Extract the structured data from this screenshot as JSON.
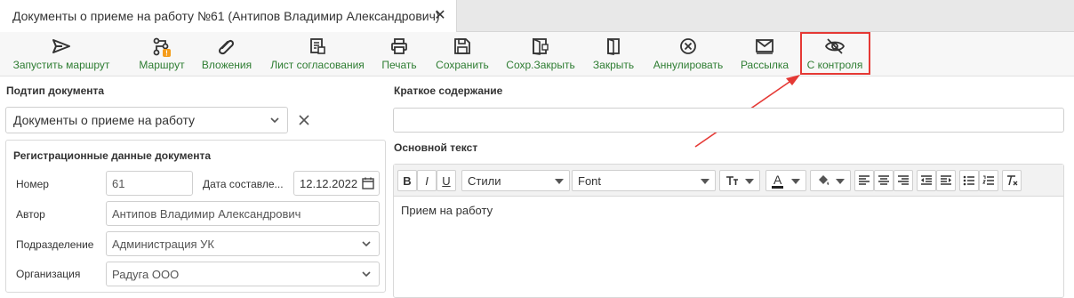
{
  "tab": {
    "title": "Документы о приеме на работу №61 (Антипов Владимир Александрович)",
    "close_icon": "close-icon"
  },
  "toolbar": {
    "buttons": [
      {
        "label": "Запустить маршрут",
        "icon": "send-icon"
      },
      {
        "label": "Маршрут",
        "icon": "route-icon"
      },
      {
        "label": "Вложения",
        "icon": "paperclip-icon"
      },
      {
        "label": "Лист согласования",
        "icon": "approval-sheet-icon"
      },
      {
        "label": "Печать",
        "icon": "printer-icon"
      },
      {
        "label": "Сохранить",
        "icon": "save-icon"
      },
      {
        "label": "Сохр.Закрыть",
        "icon": "save-close-icon"
      },
      {
        "label": "Закрыть",
        "icon": "close-door-icon"
      },
      {
        "label": "Аннулировать",
        "icon": "cancel-circle-icon"
      },
      {
        "label": "Рассылка",
        "icon": "mail-icon"
      },
      {
        "label": "С контроля",
        "icon": "eye-off-icon"
      }
    ],
    "label_color": "#2e7d32",
    "route_badge": "!"
  },
  "left": {
    "subtype_title": "Подтип документа",
    "subtype_value": "Документы о приеме на работу",
    "reg": {
      "title": "Регистрационные данные документа",
      "number_label": "Номер",
      "number_value": "61",
      "date_label": "Дата составле...",
      "date_value": "12.12.2022",
      "author_label": "Автор",
      "author_value": "Антипов Владимир Александрович",
      "dept_label": "Подразделение",
      "dept_value": "Администрация УК",
      "org_label": "Организация",
      "org_value": "Радуга ООО"
    }
  },
  "right": {
    "summary_title": "Краткое содержание",
    "summary_value": "",
    "body_title": "Основной текст",
    "editor": {
      "bold": "B",
      "italic": "I",
      "underline": "U",
      "styles_label": "Стили",
      "font_label": "Font",
      "font_color_label": "A",
      "content": "Прием на работу"
    }
  },
  "accent_color": "#e53935"
}
